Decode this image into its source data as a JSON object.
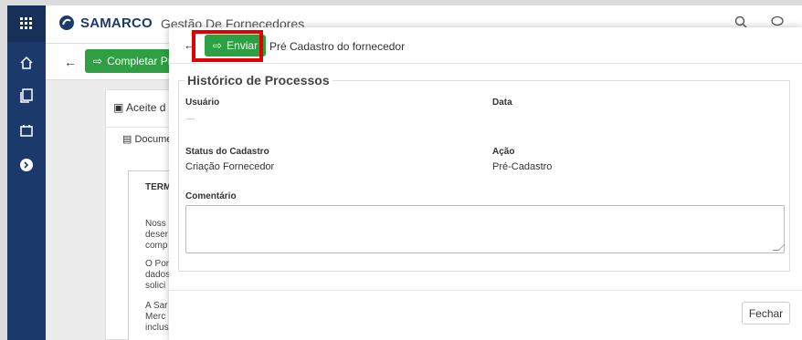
{
  "sidebar": {
    "items": [
      {
        "icon": "apps-grid-icon"
      },
      {
        "icon": "home-icon"
      },
      {
        "icon": "documents-icon"
      },
      {
        "icon": "calendar-icon"
      },
      {
        "icon": "expand-circle-icon"
      }
    ]
  },
  "header": {
    "brand": "SAMARCO",
    "app_title": "Gestão De Fornecedores"
  },
  "subbar": {
    "action_label": "Completar Pro"
  },
  "background": {
    "tab_accept": "Aceite d",
    "tab_documents": "Docume",
    "doc_title": "TERM",
    "doc_lines": [
      "Noss",
      "deser",
      "comp",
      "O Por",
      "dados",
      "solici",
      "A Sar",
      "Merc",
      "inclus"
    ]
  },
  "modal": {
    "send_label": "Enviar",
    "title": "Pré Cadastro do fornecedor",
    "section_title": "Histórico de Processos",
    "user_label": "Usuário",
    "user_value": "—",
    "date_label": "Data",
    "status_label": "Status do Cadastro",
    "status_value": "Criação Fornecedor",
    "action_label": "Ação",
    "action_value": "Pré-Cadastro",
    "comment_label": "Comentário",
    "comment_value": "",
    "close_label": "Fechar"
  },
  "colors": {
    "sidebar": "#1b3a6b",
    "brand_green": "#2ea043",
    "highlight_red": "#e00000"
  }
}
